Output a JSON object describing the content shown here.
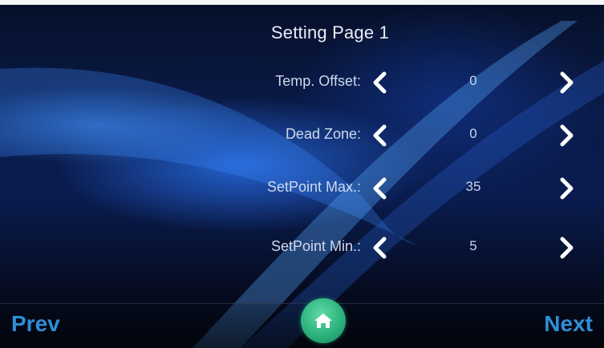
{
  "page": {
    "title": "Setting Page  1"
  },
  "settings": [
    {
      "label": "Temp. Offset:",
      "value": "0"
    },
    {
      "label": "Dead Zone:",
      "value": "0"
    },
    {
      "label": "SetPoint Max.:",
      "value": "35"
    },
    {
      "label": "SetPoint Min.:",
      "value": "5"
    }
  ],
  "nav": {
    "prev_label": "Prev",
    "next_label": "Next",
    "home_icon": "home-icon"
  },
  "icons": {
    "decrease": "chevron-left-icon",
    "increase": "chevron-right-icon"
  },
  "colors": {
    "nav_text": "#2f8fd6",
    "home_button": "#2db37c",
    "background": "#0a1a47"
  }
}
